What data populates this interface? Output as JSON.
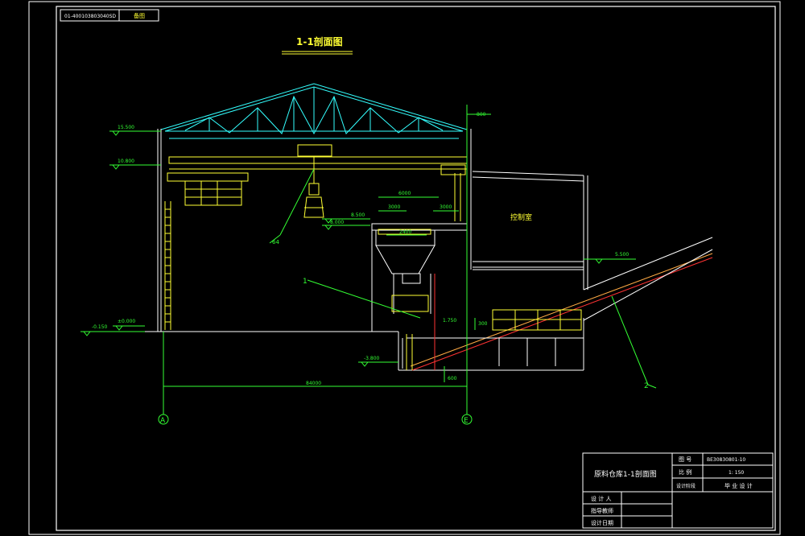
{
  "drawing": {
    "title": "1-1剖面图",
    "stamp_code": "01-400103803040SD",
    "stamp_label": "备图",
    "room_label": "控制室",
    "axis_left": "A",
    "axis_right": "E",
    "total_dim": "84000",
    "callouts": [
      "1",
      "2",
      "64"
    ],
    "elevations": [
      "15.500",
      "10.800",
      "8.500",
      "8.000",
      "5.500",
      "-0.150",
      "±0.000",
      "-3.800",
      "1.750"
    ],
    "dims": [
      "6000",
      "3000",
      "3000",
      "2400",
      "300",
      "800",
      "600"
    ]
  },
  "title_block": {
    "project_name": "原料仓库1-1剖面图",
    "drawing_no_label": "图 号",
    "drawing_no": "BE30830801-10",
    "scale_label": "比 例",
    "scale": "1: 150",
    "design_item_label": "设计阶段",
    "design_item": "毕 业 设 计",
    "designer_label": "设 计 人",
    "supervisor_label": "指导教师",
    "date_label": "设计日期"
  },
  "colors": {
    "frame": "#ffffff",
    "structure": "#ffffff",
    "crane": "#ffff33",
    "dimension": "#33ff33",
    "roof": "#33ffff",
    "hidden": "#ff3333",
    "conveyor": "#ffaa44"
  }
}
